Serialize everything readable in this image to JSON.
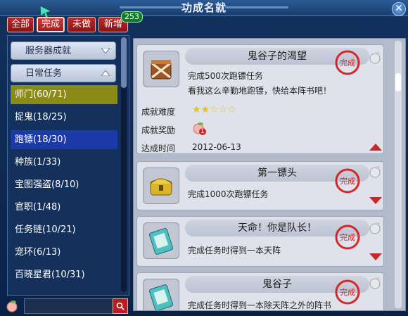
{
  "window": {
    "title": "功成名就"
  },
  "tabs": [
    {
      "label": "全部",
      "active": false
    },
    {
      "label": "完成",
      "active": true
    },
    {
      "label": "未做",
      "active": false
    },
    {
      "label": "新增",
      "active": false
    }
  ],
  "new_count": "253",
  "sidebar": {
    "groups": [
      "服务器成就",
      "日常任务"
    ],
    "items": [
      {
        "label": "师门(60/71)",
        "state": "selected-olive"
      },
      {
        "label": "捉鬼(18/25)",
        "state": "normal"
      },
      {
        "label": "跑镖(18/30)",
        "state": "selected-blue"
      },
      {
        "label": "种族(1/33)",
        "state": "normal"
      },
      {
        "label": "宝图强盗(8/10)",
        "state": "normal"
      },
      {
        "label": "官职(1/48)",
        "state": "normal"
      },
      {
        "label": "任务链(10/21)",
        "state": "normal"
      },
      {
        "label": "宠环(6/13)",
        "state": "normal"
      },
      {
        "label": "百晓星君(10/31)",
        "state": "normal"
      }
    ]
  },
  "search": {
    "placeholder": ""
  },
  "stamp_text": "完成",
  "achievements": [
    {
      "title": "鬼谷子的渴望",
      "desc": [
        "完成500次跑镖任务",
        "看我这么辛勤地跑镖，快给本阵书吧！"
      ],
      "difficulty_label": "成就难度",
      "difficulty_stars": 2,
      "difficulty_max": 5,
      "reward_label": "成就奖励",
      "reward_count": "1",
      "date_label": "达成时间",
      "date": "2012-06-13",
      "icon": "crate-icon"
    },
    {
      "title": "第一镖头",
      "desc": [
        "完成1000次跑镖任务"
      ],
      "icon": "gold-chest-icon"
    },
    {
      "title": "天命！你是队长！",
      "desc": [
        "完成任务时得到一本天阵"
      ],
      "icon": "book-icon"
    },
    {
      "title": "鬼谷子",
      "desc": [
        "完成任务时得到一本除天阵之外的阵书"
      ],
      "icon": "book-icon"
    }
  ],
  "colors": {
    "accent_red": "#c0262b",
    "selected_blue": "#1c39a8",
    "selected_olive": "#8a8a17"
  }
}
